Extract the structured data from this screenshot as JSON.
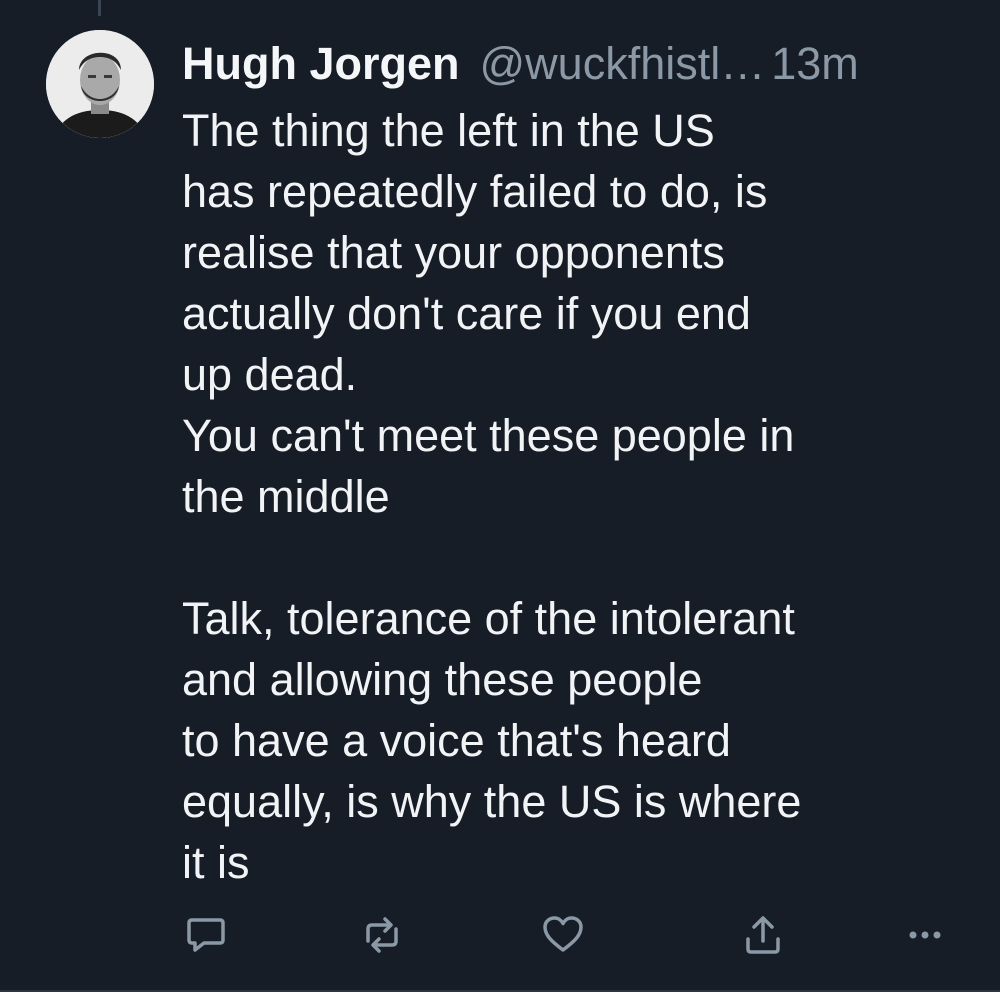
{
  "tweet": {
    "author_name": "Hugh Jorgen",
    "handle": "@wuckfhistl…",
    "timestamp": "13m",
    "text": "The thing the left in the US\nhas repeatedly failed to do, is\nrealise that your opponents\nactually don't care if you end\nup dead.\nYou can't meet these people in\nthe middle\n\nTalk, tolerance of the intolerant\nand allowing these people\nto have a voice that's heard\nequally, is why the US is where\nit is"
  },
  "actions": [
    {
      "name": "reply",
      "icon": "reply-icon"
    },
    {
      "name": "retweet",
      "icon": "retweet-icon"
    },
    {
      "name": "like",
      "icon": "heart-icon"
    },
    {
      "name": "share",
      "icon": "share-icon"
    },
    {
      "name": "more",
      "icon": "more-icon"
    }
  ],
  "colors": {
    "background": "#161d27",
    "text": "#f1f3f5",
    "secondary_text": "#8b98a5",
    "icon": "#8b98a5"
  }
}
